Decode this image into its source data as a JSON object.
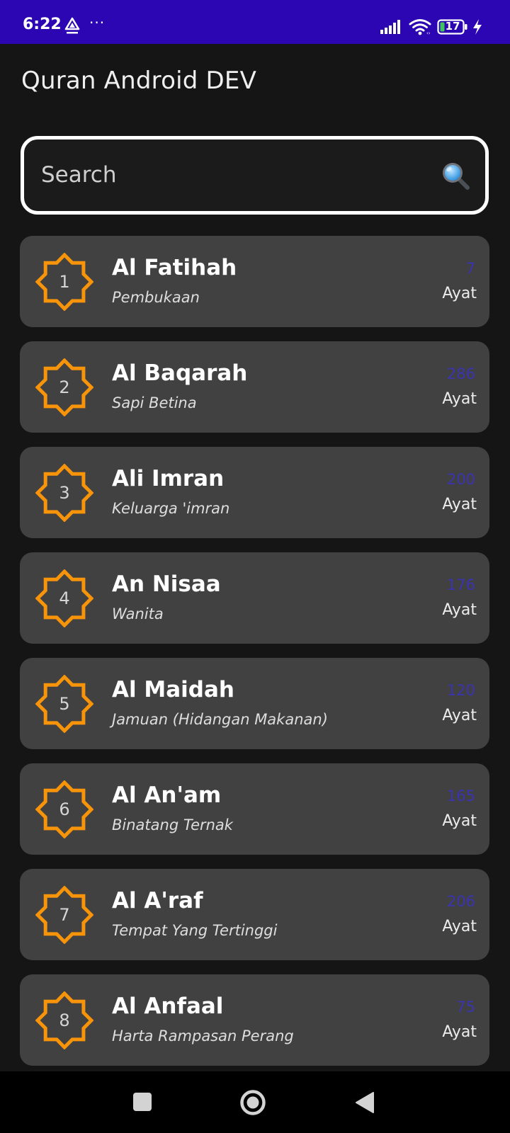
{
  "status_bar": {
    "time": "6:22",
    "app_icon_label": "AstraPay",
    "more": "···",
    "battery": "17",
    "icons": [
      "astrapay-icon",
      "more-dots-icon",
      "signal-icon",
      "wifi-icon",
      "battery-icon",
      "charging-bolt-icon"
    ]
  },
  "app": {
    "title": "Quran Android DEV"
  },
  "search": {
    "placeholder": "Search",
    "value": "",
    "icon": "search-icon"
  },
  "colors": {
    "status_bar_bg": "#2d06b3",
    "background": "#151515",
    "card_bg": "#414141",
    "badge_orange": "#f7940a",
    "ayat_count": "#3b34b0"
  },
  "surahs": [
    {
      "number": "1",
      "name": "Al Fatihah",
      "meaning": "Pembukaan",
      "ayat_count": "7",
      "ayat_label": "Ayat"
    },
    {
      "number": "2",
      "name": "Al Baqarah",
      "meaning": "Sapi Betina",
      "ayat_count": "286",
      "ayat_label": "Ayat"
    },
    {
      "number": "3",
      "name": "Ali Imran",
      "meaning": "Keluarga 'imran",
      "ayat_count": "200",
      "ayat_label": "Ayat"
    },
    {
      "number": "4",
      "name": "An Nisaa",
      "meaning": "Wanita",
      "ayat_count": "176",
      "ayat_label": "Ayat"
    },
    {
      "number": "5",
      "name": "Al Maidah",
      "meaning": "Jamuan (Hidangan Makanan)",
      "ayat_count": "120",
      "ayat_label": "Ayat"
    },
    {
      "number": "6",
      "name": "Al An'am",
      "meaning": "Binatang Ternak",
      "ayat_count": "165",
      "ayat_label": "Ayat"
    },
    {
      "number": "7",
      "name": "Al A'raf",
      "meaning": "Tempat Yang Tertinggi",
      "ayat_count": "206",
      "ayat_label": "Ayat"
    },
    {
      "number": "8",
      "name": "Al Anfaal",
      "meaning": "Harta Rampasan Perang",
      "ayat_count": "75",
      "ayat_label": "Ayat"
    }
  ],
  "nav_bar": {
    "icons": [
      "recent-apps-icon",
      "home-icon",
      "back-icon"
    ]
  }
}
